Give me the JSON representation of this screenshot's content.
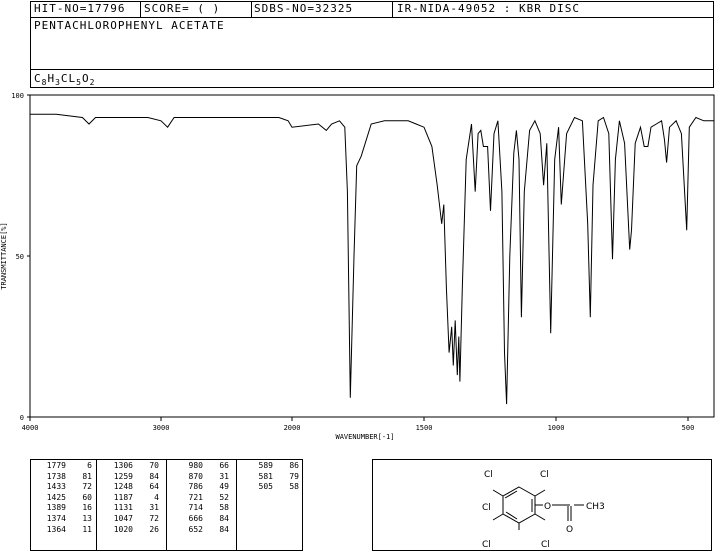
{
  "header": {
    "hit_no": "HIT-NO=17796",
    "score": "SCORE=  (   )",
    "sdbs_no": "SDBS-NO=32325",
    "ir_nida": "IR-NIDA-49052 : KBR DISC",
    "compound_name": "PENTACHLOROPHENYL ACETATE",
    "formula_parts": [
      "C",
      "8",
      "H",
      "3",
      "CL",
      "5",
      "O",
      "2"
    ]
  },
  "chart_data": {
    "type": "line",
    "xlabel": "WAVENUMBER[-1]",
    "ylabel": "TRANSMITTANCE[%]",
    "xlim": [
      4000,
      400
    ],
    "ylim": [
      0,
      100
    ],
    "x_ticks": [
      4000,
      3000,
      2000,
      1500,
      1000,
      500
    ],
    "y_ticks": [
      0,
      50,
      100
    ],
    "series": [
      {
        "color": "#000000",
        "x": [
          4000,
          3800,
          3600,
          3550,
          3500,
          3300,
          3100,
          3000,
          2950,
          2900,
          2600,
          2100,
          2030,
          2000,
          1900,
          1870,
          1850,
          1820,
          1800,
          1790,
          1779,
          1765,
          1755,
          1738,
          1700,
          1650,
          1600,
          1560,
          1530,
          1500,
          1470,
          1450,
          1433,
          1425,
          1415,
          1405,
          1395,
          1389,
          1382,
          1374,
          1368,
          1364,
          1355,
          1340,
          1320,
          1306,
          1295,
          1285,
          1275,
          1259,
          1248,
          1235,
          1220,
          1205,
          1195,
          1187,
          1175,
          1160,
          1150,
          1140,
          1131,
          1120,
          1100,
          1080,
          1060,
          1047,
          1035,
          1020,
          1005,
          990,
          980,
          960,
          930,
          900,
          880,
          870,
          860,
          840,
          820,
          800,
          786,
          775,
          760,
          740,
          721,
          714,
          700,
          680,
          666,
          652,
          640,
          620,
          600,
          589,
          581,
          570,
          545,
          525,
          505,
          495,
          470,
          440,
          420,
          400
        ],
        "y": [
          94,
          94,
          93,
          91,
          93,
          93,
          93,
          92,
          90,
          93,
          93,
          93,
          92,
          90,
          91,
          89,
          91,
          92,
          90,
          70,
          6,
          50,
          78,
          81,
          91,
          92,
          92,
          92,
          91,
          90,
          84,
          72,
          60,
          66,
          40,
          20,
          28,
          16,
          30,
          13,
          25,
          11,
          40,
          80,
          91,
          70,
          88,
          89,
          84,
          84,
          64,
          88,
          92,
          70,
          20,
          4,
          50,
          82,
          89,
          80,
          31,
          70,
          89,
          92,
          88,
          72,
          85,
          26,
          80,
          90,
          66,
          88,
          93,
          92,
          60,
          31,
          72,
          92,
          93,
          88,
          49,
          80,
          92,
          85,
          52,
          58,
          85,
          90,
          84,
          84,
          90,
          91,
          92,
          86,
          79,
          90,
          92,
          88,
          58,
          90,
          93,
          92,
          92,
          92
        ]
      }
    ]
  },
  "peak_table": [
    [
      [
        "1779",
        "6"
      ],
      [
        "1738",
        "81"
      ],
      [
        "1433",
        "72"
      ],
      [
        "1425",
        "60"
      ],
      [
        "1389",
        "16"
      ],
      [
        "1374",
        "13"
      ],
      [
        "1364",
        "11"
      ]
    ],
    [
      [
        "1306",
        "70"
      ],
      [
        "1259",
        "84"
      ],
      [
        "1248",
        "64"
      ],
      [
        "1187",
        "4"
      ],
      [
        "1131",
        "31"
      ],
      [
        "1047",
        "72"
      ],
      [
        "1020",
        "26"
      ]
    ],
    [
      [
        "980",
        "66"
      ],
      [
        "870",
        "31"
      ],
      [
        "786",
        "49"
      ],
      [
        "721",
        "52"
      ],
      [
        "714",
        "58"
      ],
      [
        "666",
        "84"
      ],
      [
        "652",
        "84"
      ]
    ],
    [
      [
        "589",
        "86"
      ],
      [
        "581",
        "79"
      ],
      [
        "505",
        "58"
      ]
    ]
  ],
  "structure": {
    "atom_labels": [
      "Cl",
      "Cl",
      "Cl",
      "Cl",
      "Cl",
      "O",
      "O",
      "CH3"
    ]
  }
}
